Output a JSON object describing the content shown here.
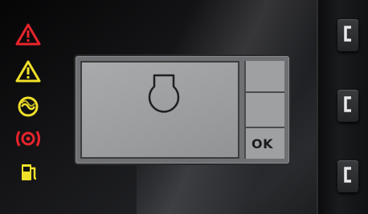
{
  "panel": {
    "indicators": [
      {
        "name": "alarm-warning-icon",
        "color": "#e8242c"
      },
      {
        "name": "caution-warning-icon",
        "color": "#f0e02a"
      },
      {
        "name": "glow-plug-icon",
        "color": "#f0e02a"
      },
      {
        "name": "brake-warning-icon",
        "color": "#e8242c"
      },
      {
        "name": "fuel-icon",
        "color": "#f0e02a"
      }
    ],
    "display": {
      "symbol": "engine-coolant-icon",
      "softkeys": [
        "",
        "",
        "OK"
      ]
    },
    "side_buttons": [
      {
        "name": "side-button-1-icon"
      },
      {
        "name": "side-button-2-icon"
      },
      {
        "name": "side-button-3-icon"
      }
    ]
  }
}
